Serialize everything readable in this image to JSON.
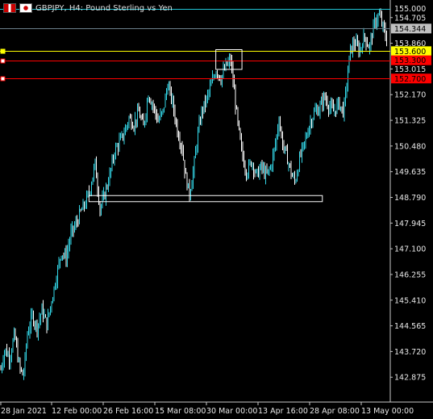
{
  "header": {
    "title": "GBPJPY, H4:  Pound Sterling vs Yen",
    "flag_left_icon": "uk-flag-icon",
    "flag_right_icon": "japan-flag-icon"
  },
  "colors": {
    "background": "#000000",
    "candle": "#33d6e6",
    "candle_light": "#ffffff",
    "grid_axis": "#c8c8c8",
    "level_cyan": "#22c6d6",
    "level_yellow": "#ffff00",
    "level_red": "#ff0000",
    "current_price_bg": "#c0c0c0"
  },
  "chart_data": {
    "type": "candlestick",
    "title": "GBPJPY, H4:  Pound Sterling vs Yen",
    "xlabel": "",
    "ylabel": "",
    "ylim": [
      142.35,
      155.15
    ],
    "grid": false,
    "y_ticks": [
      "155.000",
      "154.705",
      "154.344",
      "153.860",
      "153.600",
      "153.300",
      "153.015",
      "152.700",
      "152.170",
      "151.325",
      "150.480",
      "149.635",
      "148.790",
      "147.945",
      "147.100",
      "146.255",
      "145.410",
      "144.565",
      "143.720",
      "142.875"
    ],
    "x_ticks": [
      "28 Jan 2021",
      "12 Feb 00:00",
      "26 Feb 16:00",
      "15 Mar 08:00",
      "30 Mar 00:00",
      "13 Apr 16:00",
      "28 Apr 08:00",
      "13 May 00:00"
    ],
    "price_path": [
      [
        0,
        143.0
      ],
      [
        6,
        143.8
      ],
      [
        12,
        143.5
      ],
      [
        18,
        144.3
      ],
      [
        24,
        143.2
      ],
      [
        29,
        142.9
      ],
      [
        34,
        144.3
      ],
      [
        40,
        144.9
      ],
      [
        46,
        144.5
      ],
      [
        52,
        145.1
      ],
      [
        58,
        144.6
      ],
      [
        64,
        145.4
      ],
      [
        70,
        146.2
      ],
      [
        76,
        147.0
      ],
      [
        82,
        146.8
      ],
      [
        88,
        147.6
      ],
      [
        94,
        147.9
      ],
      [
        100,
        148.3
      ],
      [
        106,
        148.6
      ],
      [
        112,
        149.1
      ],
      [
        118,
        149.9
      ],
      [
        124,
        148.4
      ],
      [
        130,
        148.9
      ],
      [
        136,
        149.5
      ],
      [
        142,
        150.3
      ],
      [
        148,
        150.6
      ],
      [
        154,
        150.9
      ],
      [
        160,
        151.4
      ],
      [
        166,
        151.2
      ],
      [
        172,
        151.6
      ],
      [
        178,
        151.1
      ],
      [
        184,
        152.2
      ],
      [
        190,
        151.8
      ],
      [
        196,
        151.3
      ],
      [
        202,
        151.6
      ],
      [
        208,
        152.5
      ],
      [
        214,
        151.9
      ],
      [
        220,
        151.0
      ],
      [
        226,
        150.4
      ],
      [
        230,
        149.5
      ],
      [
        235,
        148.9
      ],
      [
        240,
        149.7
      ],
      [
        245,
        150.8
      ],
      [
        250,
        151.6
      ],
      [
        256,
        152.0
      ],
      [
        262,
        152.5
      ],
      [
        268,
        153.0
      ],
      [
        274,
        152.7
      ],
      [
        280,
        153.1
      ],
      [
        286,
        153.3
      ],
      [
        290,
        152.4
      ],
      [
        294,
        151.4
      ],
      [
        298,
        150.6
      ],
      [
        302,
        150.0
      ],
      [
        306,
        149.6
      ],
      [
        312,
        150.0
      ],
      [
        318,
        149.5
      ],
      [
        324,
        149.8
      ],
      [
        330,
        149.5
      ],
      [
        336,
        149.8
      ],
      [
        342,
        150.6
      ],
      [
        346,
        151.4
      ],
      [
        350,
        150.6
      ],
      [
        356,
        150.1
      ],
      [
        362,
        149.5
      ],
      [
        366,
        149.3
      ],
      [
        372,
        150.1
      ],
      [
        378,
        150.6
      ],
      [
        384,
        151.2
      ],
      [
        390,
        151.6
      ],
      [
        396,
        151.7
      ],
      [
        402,
        152.1
      ],
      [
        408,
        151.8
      ],
      [
        414,
        151.6
      ],
      [
        420,
        151.9
      ],
      [
        426,
        151.6
      ],
      [
        430,
        152.5
      ],
      [
        434,
        153.6
      ],
      [
        440,
        153.9
      ],
      [
        446,
        153.6
      ],
      [
        452,
        154.1
      ],
      [
        458,
        153.7
      ],
      [
        464,
        154.5
      ],
      [
        470,
        154.8
      ],
      [
        476,
        154.3
      ],
      [
        480,
        153.9
      ]
    ],
    "horizontal_levels": [
      {
        "price": 155.0,
        "label": "155.000",
        "color": "#22c6d6",
        "role": "cyan-level"
      },
      {
        "price": 154.344,
        "label": "154.344",
        "color": "#c0c0c0",
        "role": "current-price"
      },
      {
        "price": 153.6,
        "label": "153.600",
        "color": "#ffff00",
        "role": "yellow-level"
      },
      {
        "price": 153.3,
        "label": "153.300",
        "color": "#ff0000",
        "role": "red-level"
      },
      {
        "price": 152.7,
        "label": "152.700",
        "color": "#ff0000",
        "role": "red-level"
      }
    ],
    "rectangles": [
      {
        "x0_frac": 0.553,
        "x1_frac": 0.62,
        "y_top": 153.65,
        "y_bottom": 153.0,
        "color": "#ffffff"
      },
      {
        "x0_frac": 0.228,
        "x1_frac": 0.826,
        "y_top": 148.85,
        "y_bottom": 148.65,
        "color": "#ffffff"
      }
    ]
  }
}
